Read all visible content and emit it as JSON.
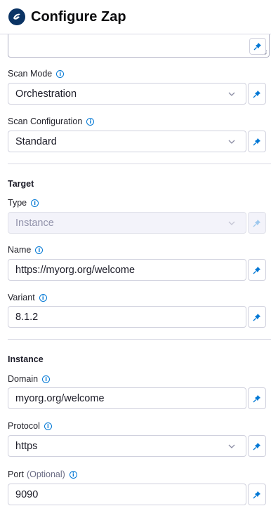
{
  "header": {
    "title": "Configure Zap",
    "logo_icon": "zap-logo-icon"
  },
  "fields": {
    "scan_mode": {
      "label": "Scan Mode",
      "value": "Orchestration"
    },
    "scan_configuration": {
      "label": "Scan Configuration",
      "value": "Standard"
    },
    "target_type": {
      "label": "Type",
      "value": "Instance"
    },
    "target_name": {
      "label": "Name",
      "value": "https://myorg.org/welcome"
    },
    "target_variant": {
      "label": "Variant",
      "value": "8.1.2"
    },
    "instance_domain": {
      "label": "Domain",
      "value": "myorg.org/welcome"
    },
    "instance_protocol": {
      "label": "Protocol",
      "value": "https"
    },
    "instance_port": {
      "label": "Port",
      "optional": "(Optional)",
      "value": "9090"
    }
  },
  "sections": {
    "target": "Target",
    "instance": "Instance"
  },
  "colors": {
    "accent": "#0278d5",
    "border": "#d0d1de",
    "disabled_bg": "#f3f3fa"
  },
  "info_glyph": "i"
}
